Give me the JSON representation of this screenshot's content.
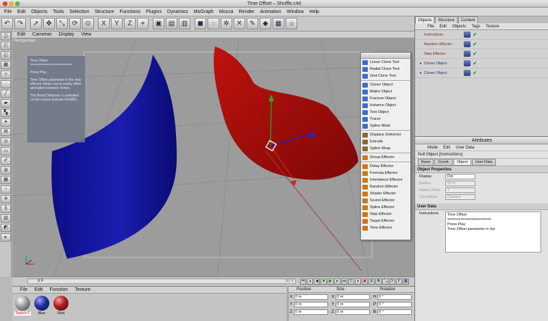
{
  "window": {
    "title": "Time Offset – Shuffle.c4d"
  },
  "menubar": [
    "File",
    "Edit",
    "Objects",
    "Tools",
    "Selection",
    "Structure",
    "Functions",
    "Plugins",
    "Dynamics",
    "MoGraph",
    "Mocca",
    "Render",
    "Animation",
    "Window",
    "Help"
  ],
  "viewport": {
    "menu": [
      "Edit",
      "Cameras",
      "Display",
      "View"
    ],
    "label": "Perspective",
    "note": {
      "title": "Time Offset",
      "divider": "=====================",
      "lines": [
        "Press Play",
        "Time Offset parameter in the step effector allows you to easily offset animation between clones.",
        "The Bend Deformer is animated on the source Extrude NURBS."
      ]
    }
  },
  "popup_menu": {
    "groups": [
      [
        "Linear Clone Tool",
        "Radial Clone Tool",
        "Grid Clone Tool"
      ],
      [
        "Cloner Object",
        "Matrix Object",
        "Fracture Object",
        "Instance Object",
        "Text Object",
        "Tracer",
        "Spline Mask"
      ],
      [
        "Displace Deformer",
        "Extrude",
        "Spline Wrap"
      ],
      [
        "Group Effector"
      ],
      [
        "Delay Effector",
        "Formula Effector",
        "Inheritance Effector",
        "Random Effector",
        "Shader Effector",
        "Sound Effector",
        "Spline Effector",
        "Step Effector",
        "Target Effector",
        "Time Effector"
      ]
    ]
  },
  "timeline": {
    "start": "0 F",
    "end": "90 F"
  },
  "materials": {
    "menu": [
      "File",
      "Edit",
      "Function",
      "Texture"
    ],
    "items": [
      {
        "name": "Switch F",
        "color": "#9a9a9a"
      },
      {
        "name": "Blue",
        "color": "#1f2f9a"
      },
      {
        "name": "Red",
        "color": "#a81d1d"
      }
    ]
  },
  "coordinates": {
    "headers": [
      "Position",
      "Size",
      "Rotation"
    ],
    "rows": [
      {
        "axis": "X",
        "pos": "0 m",
        "size_axis": "X",
        "size": "0 m",
        "rot_axis": "H",
        "rot": "0 °"
      },
      {
        "axis": "Y",
        "pos": "0 m",
        "size_axis": "Y",
        "size": "0 m",
        "rot_axis": "P",
        "rot": "0 °"
      },
      {
        "axis": "Z",
        "pos": "0 m",
        "size_axis": "Z",
        "size": "0 m",
        "rot_axis": "B",
        "rot": "0 °"
      }
    ]
  },
  "object_manager": {
    "tabs": [
      "Objects",
      "Structure",
      "Content"
    ],
    "menu": [
      "File",
      "Edit",
      "Objects",
      "Tags",
      "Texture"
    ],
    "objects": [
      "Instructions",
      "Random Effector",
      "Step Effector",
      "Cloner Object",
      "Cloner Object"
    ]
  },
  "attributes": {
    "title": "Attributes",
    "menu": [
      "Mode",
      "Edit",
      "User Data"
    ],
    "object_title": "Null Object [Instructions]",
    "tabs": [
      "Basic",
      "Coord.",
      "Object",
      "User Data"
    ],
    "section_props": "Object Properties",
    "props": [
      {
        "label": "Display",
        "value": "Dot"
      },
      {
        "label": "Radius",
        "value": "10 m"
      },
      {
        "label": "Aspect Ratio",
        "value": "1"
      },
      {
        "label": "Orientation",
        "value": "Camera"
      }
    ],
    "section_user": "User Data",
    "user_label": "Instructions",
    "user_lines": [
      "Time Offset",
      "====================",
      "Press Play",
      "Time Offset parameter in the"
    ]
  },
  "colors": {
    "accent": "#2f5bb7",
    "blue_object": "#13149a",
    "red_object": "#b0100c",
    "viewport_bg": "#9c9c9c"
  }
}
